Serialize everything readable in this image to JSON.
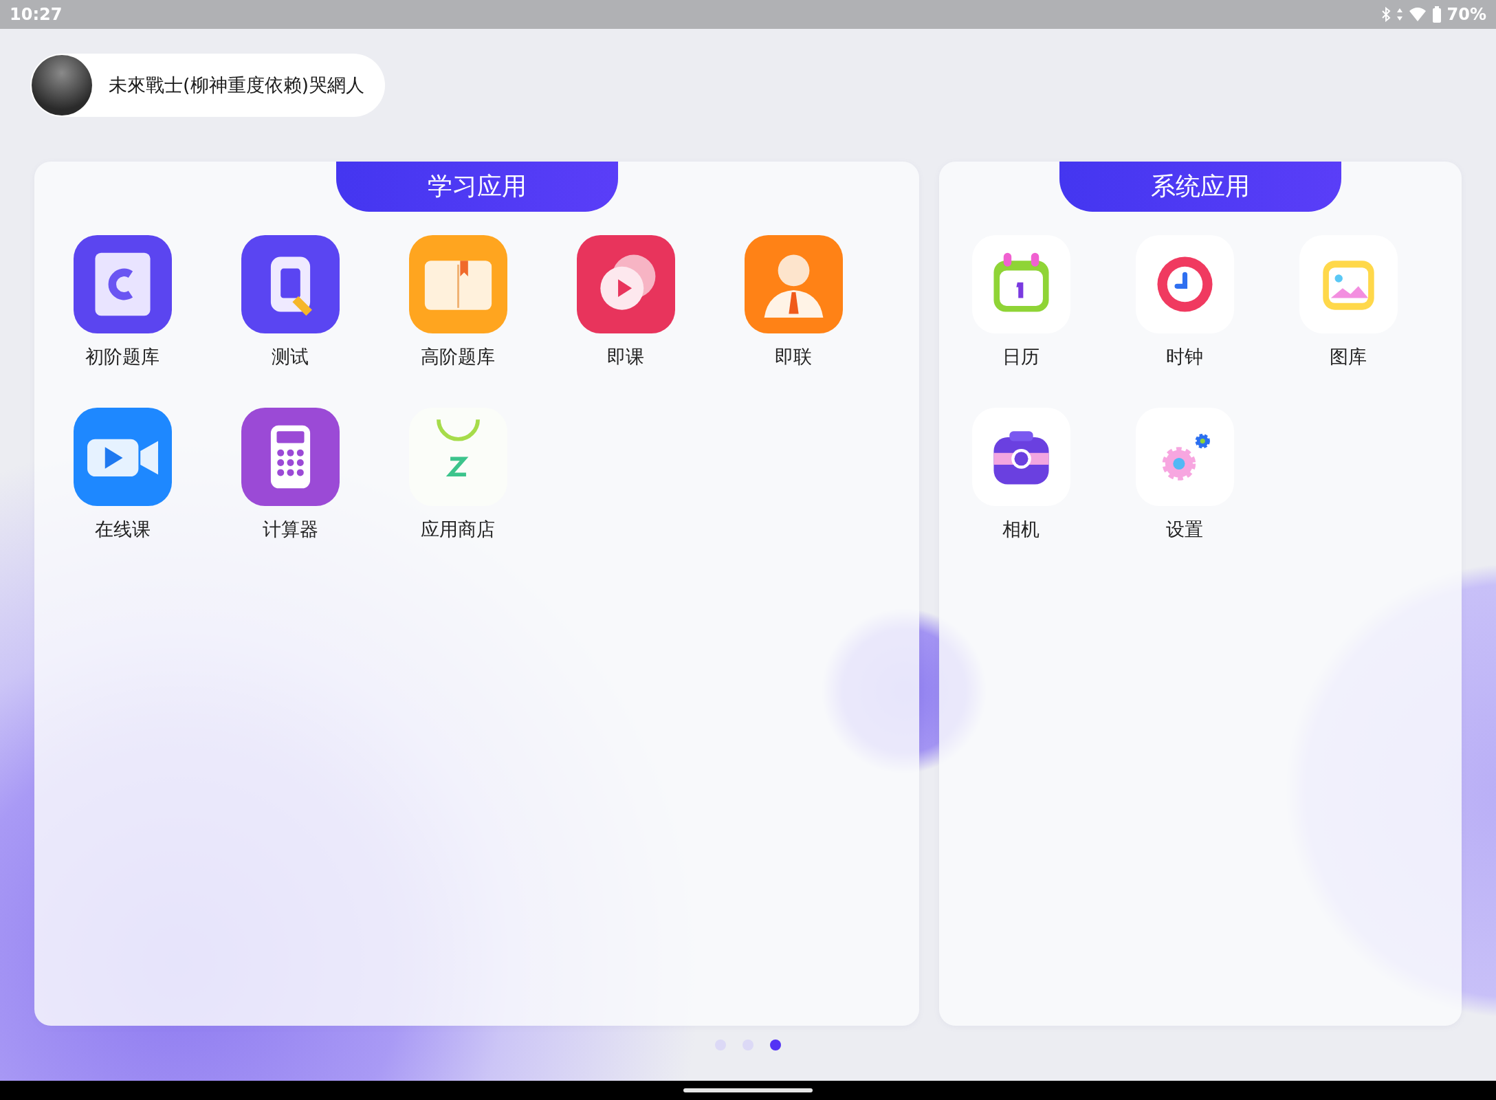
{
  "status_bar": {
    "time": "10:27",
    "battery": "70%"
  },
  "profile": {
    "name": "未來戰士(柳神重度依赖)哭網人"
  },
  "panels": [
    {
      "title": "学习应用",
      "apps": [
        {
          "label": "初阶题库",
          "kind": "notebook"
        },
        {
          "label": "测试",
          "kind": "quiz"
        },
        {
          "label": "高阶题库",
          "kind": "book"
        },
        {
          "label": "即课",
          "kind": "play-bubble"
        },
        {
          "label": "即联",
          "kind": "person"
        },
        {
          "label": "在线课",
          "kind": "video"
        },
        {
          "label": "计算器",
          "kind": "calculator"
        },
        {
          "label": "应用商店",
          "kind": "store"
        }
      ]
    },
    {
      "title": "系统应用",
      "apps": [
        {
          "label": "日历",
          "kind": "calendar"
        },
        {
          "label": "时钟",
          "kind": "clock"
        },
        {
          "label": "图库",
          "kind": "gallery"
        },
        {
          "label": "相机",
          "kind": "camera"
        },
        {
          "label": "设置",
          "kind": "settings"
        }
      ]
    }
  ],
  "pages": [
    {
      "selected": false
    },
    {
      "selected": false
    },
    {
      "selected": true
    }
  ]
}
